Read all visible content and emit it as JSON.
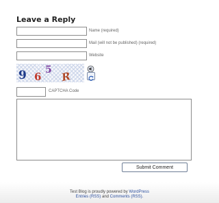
{
  "form": {
    "title": "Leave a Reply",
    "name_label": "Name (required)",
    "mail_label": "Mail (will not be published) (required)",
    "website_label": "Website",
    "name_value": "",
    "mail_value": "",
    "website_value": "",
    "captcha_text": "965R",
    "captcha_label": "CAPTCHA Code",
    "captcha_value": "",
    "comment_value": "",
    "submit_label": "Submit Comment"
  },
  "icons": {
    "audio": "audio-icon",
    "refresh": "refresh-icon"
  },
  "footer": {
    "line1_prefix": "Test Blog is proudly powered by",
    "wordpress": "WordPress",
    "entries_rss": "Entries (RSS)",
    "and": "and",
    "comments_rss": "Comments (RSS).",
    "link_color": "#2c4f9e"
  }
}
